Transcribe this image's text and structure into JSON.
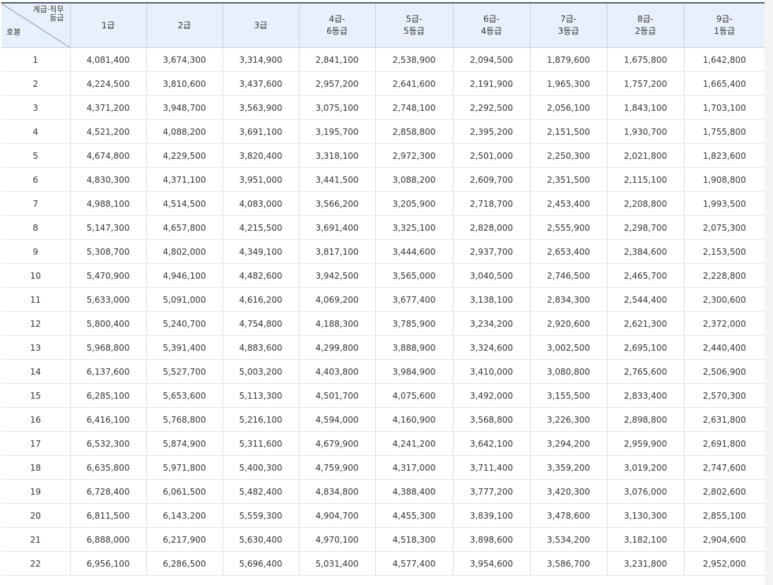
{
  "header": {
    "corner_top": "계급·직무\n등급",
    "corner_top_line1": "계급·직무",
    "corner_top_line2": "등급",
    "corner_bottom": "호봉",
    "grades": [
      {
        "line1": "1급",
        "line2": ""
      },
      {
        "line1": "2급",
        "line2": ""
      },
      {
        "line1": "3급",
        "line2": ""
      },
      {
        "line1": "4급-",
        "line2": "6등급"
      },
      {
        "line1": "5급-",
        "line2": "5등급"
      },
      {
        "line1": "6급-",
        "line2": "4등급"
      },
      {
        "line1": "7급-",
        "line2": "3등급"
      },
      {
        "line1": "8급-",
        "line2": "2등급"
      },
      {
        "line1": "9급-",
        "line2": "1등급"
      }
    ]
  },
  "rows": [
    {
      "step": "1",
      "values": [
        "4,081,400",
        "3,674,300",
        "3,314,900",
        "2,841,100",
        "2,538,900",
        "2,094,500",
        "1,879,600",
        "1,675,800",
        "1,642,800"
      ]
    },
    {
      "step": "2",
      "values": [
        "4,224,500",
        "3,810,600",
        "3,437,600",
        "2,957,200",
        "2,641,600",
        "2,191,900",
        "1,965,300",
        "1,757,200",
        "1,665,400"
      ]
    },
    {
      "step": "3",
      "values": [
        "4,371,200",
        "3,948,700",
        "3,563,900",
        "3,075,100",
        "2,748,100",
        "2,292,500",
        "2,056,100",
        "1,843,100",
        "1,703,100"
      ]
    },
    {
      "step": "4",
      "values": [
        "4,521,200",
        "4,088,200",
        "3,691,100",
        "3,195,700",
        "2,858,800",
        "2,395,200",
        "2,151,500",
        "1,930,700",
        "1,755,800"
      ]
    },
    {
      "step": "5",
      "values": [
        "4,674,800",
        "4,229,500",
        "3,820,400",
        "3,318,100",
        "2,972,300",
        "2,501,000",
        "2,250,300",
        "2,021,800",
        "1,823,600"
      ]
    },
    {
      "step": "6",
      "values": [
        "4,830,300",
        "4,371,100",
        "3,951,000",
        "3,441,500",
        "3,088,200",
        "2,609,700",
        "2,351,500",
        "2,115,100",
        "1,908,800"
      ]
    },
    {
      "step": "7",
      "values": [
        "4,988,100",
        "4,514,500",
        "4,083,000",
        "3,566,200",
        "3,205,900",
        "2,718,700",
        "2,453,400",
        "2,208,800",
        "1,993,500"
      ]
    },
    {
      "step": "8",
      "values": [
        "5,147,300",
        "4,657,800",
        "4,215,500",
        "3,691,400",
        "3,325,100",
        "2,828,000",
        "2,555,900",
        "2,298,700",
        "2,075,300"
      ]
    },
    {
      "step": "9",
      "values": [
        "5,308,700",
        "4,802,000",
        "4,349,100",
        "3,817,100",
        "3,444,600",
        "2,937,700",
        "2,653,400",
        "2,384,600",
        "2,153,500"
      ]
    },
    {
      "step": "10",
      "values": [
        "5,470,900",
        "4,946,100",
        "4,482,600",
        "3,942,500",
        "3,565,000",
        "3,040,500",
        "2,746,500",
        "2,465,700",
        "2,228,800"
      ]
    },
    {
      "step": "11",
      "values": [
        "5,633,000",
        "5,091,000",
        "4,616,200",
        "4,069,200",
        "3,677,400",
        "3,138,100",
        "2,834,300",
        "2,544,400",
        "2,300,600"
      ]
    },
    {
      "step": "12",
      "values": [
        "5,800,400",
        "5,240,700",
        "4,754,800",
        "4,188,300",
        "3,785,900",
        "3,234,200",
        "2,920,600",
        "2,621,300",
        "2,372,000"
      ]
    },
    {
      "step": "13",
      "values": [
        "5,968,800",
        "5,391,400",
        "4,883,600",
        "4,299,800",
        "3,888,900",
        "3,324,600",
        "3,002,500",
        "2,695,100",
        "2,440,400"
      ]
    },
    {
      "step": "14",
      "values": [
        "6,137,600",
        "5,527,700",
        "5,003,200",
        "4,403,800",
        "3,984,900",
        "3,410,000",
        "3,080,800",
        "2,765,600",
        "2,506,900"
      ]
    },
    {
      "step": "15",
      "values": [
        "6,285,100",
        "5,653,600",
        "5,113,300",
        "4,501,700",
        "4,075,600",
        "3,492,000",
        "3,155,500",
        "2,833,400",
        "2,570,300"
      ]
    },
    {
      "step": "16",
      "values": [
        "6,416,100",
        "5,768,800",
        "5,216,100",
        "4,594,000",
        "4,160,900",
        "3,568,800",
        "3,226,300",
        "2,898,800",
        "2,631,800"
      ]
    },
    {
      "step": "17",
      "values": [
        "6,532,300",
        "5,874,900",
        "5,311,600",
        "4,679,900",
        "4,241,200",
        "3,642,100",
        "3,294,200",
        "2,959,900",
        "2,691,800"
      ]
    },
    {
      "step": "18",
      "values": [
        "6,635,800",
        "5,971,800",
        "5,400,300",
        "4,759,900",
        "4,317,000",
        "3,711,400",
        "3,359,200",
        "3,019,200",
        "2,747,600"
      ]
    },
    {
      "step": "19",
      "values": [
        "6,728,400",
        "6,061,500",
        "5,482,400",
        "4,834,800",
        "4,388,400",
        "3,777,200",
        "3,420,300",
        "3,076,000",
        "2,802,600"
      ]
    },
    {
      "step": "20",
      "values": [
        "6,811,500",
        "6,143,200",
        "5,559,300",
        "4,904,700",
        "4,455,300",
        "3,839,100",
        "3,478,600",
        "3,130,300",
        "2,855,100"
      ]
    },
    {
      "step": "21",
      "values": [
        "6,888,000",
        "6,217,900",
        "5,630,400",
        "4,970,100",
        "4,518,300",
        "3,898,600",
        "3,534,200",
        "3,182,100",
        "2,904,600"
      ]
    },
    {
      "step": "22",
      "values": [
        "6,956,100",
        "6,286,500",
        "5,696,400",
        "5,031,400",
        "4,577,400",
        "3,954,600",
        "3,586,700",
        "3,231,800",
        "2,952,000"
      ]
    }
  ]
}
